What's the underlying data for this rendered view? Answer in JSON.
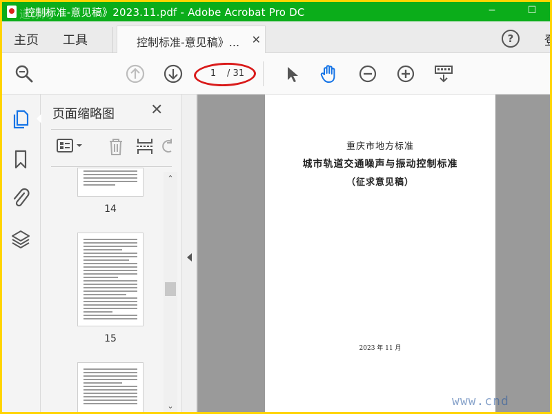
{
  "titlebar": {
    "title": "控制标准-意见稿》2023.11.pdf - Adobe Acrobat Pro DC",
    "watermark": "道标网",
    "minimize": "−",
    "maximize": "☐"
  },
  "tabs": {
    "home": "主页",
    "tools": "工具",
    "document_tab": "控制标准-意见稿》...",
    "close": "✕",
    "help": "?",
    "login": "登"
  },
  "toolbar": {
    "current_page": "1",
    "total_pages": "/ 31",
    "highlight_color": "#d91a1a",
    "active_tool_color": "#1473e6"
  },
  "thumbnails_panel": {
    "title": "页面缩略图",
    "close": "✕",
    "pages": [
      {
        "number": "14"
      },
      {
        "number": "15"
      },
      {
        "number": ""
      }
    ]
  },
  "document_page": {
    "line1": "重庆市地方标准",
    "line2": "城市轨道交通噪声与振动控制标准",
    "line3": "（征求意见稿）",
    "date": "2023 年 11 月"
  },
  "site_watermark": "www.cnd",
  "colors": {
    "titlebar": "#0bad1a",
    "border": "#ffd400",
    "icon_blue": "#1473e6"
  }
}
